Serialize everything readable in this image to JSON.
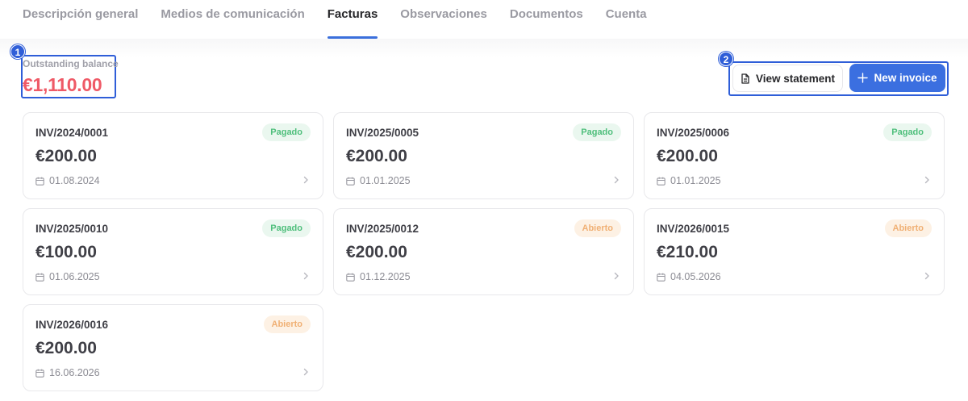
{
  "tabs": [
    {
      "label": "Descripción general",
      "active": false
    },
    {
      "label": "Medios de comunicación",
      "active": false
    },
    {
      "label": "Facturas",
      "active": true
    },
    {
      "label": "Observaciones",
      "active": false
    },
    {
      "label": "Documentos",
      "active": false
    },
    {
      "label": "Cuenta",
      "active": false
    }
  ],
  "annotations": {
    "balance_marker": "1",
    "actions_marker": "2"
  },
  "balance": {
    "label": "Outstanding balance",
    "value": "€1,110.00",
    "color": "#ef5a67"
  },
  "actions": {
    "statement_label": "View statement",
    "statement_icon": "document-icon",
    "new_label": "New invoice",
    "new_icon": "plus-icon"
  },
  "colors": {
    "accent": "#3b6fe0",
    "paid": "#4fbf7c",
    "open": "#f0b074"
  },
  "invoices": [
    {
      "number": "INV/2024/0001",
      "amount": "€200.00",
      "date": "01.08.2024",
      "status": "Pagado",
      "status_type": "paid"
    },
    {
      "number": "INV/2025/0005",
      "amount": "€200.00",
      "date": "01.01.2025",
      "status": "Pagado",
      "status_type": "paid"
    },
    {
      "number": "INV/2025/0006",
      "amount": "€200.00",
      "date": "01.01.2025",
      "status": "Pagado",
      "status_type": "paid"
    },
    {
      "number": "INV/2025/0010",
      "amount": "€100.00",
      "date": "01.06.2025",
      "status": "Pagado",
      "status_type": "paid"
    },
    {
      "number": "INV/2025/0012",
      "amount": "€200.00",
      "date": "01.12.2025",
      "status": "Abierto",
      "status_type": "open"
    },
    {
      "number": "INV/2026/0015",
      "amount": "€210.00",
      "date": "04.05.2026",
      "status": "Abierto",
      "status_type": "open"
    },
    {
      "number": "INV/2026/0016",
      "amount": "€200.00",
      "date": "16.06.2026",
      "status": "Abierto",
      "status_type": "open"
    }
  ]
}
